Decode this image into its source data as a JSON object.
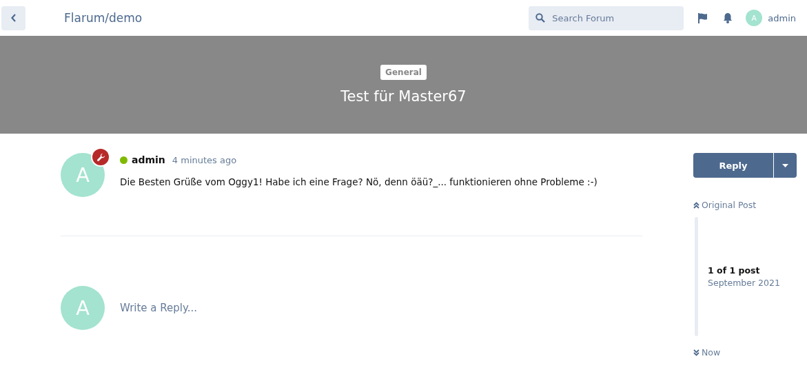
{
  "header": {
    "title": "Flarum/demo",
    "search": {
      "placeholder": "Search Forum"
    },
    "user": {
      "avatar_letter": "A",
      "name": "admin"
    }
  },
  "hero": {
    "tag": "General",
    "title": "Test für Master67"
  },
  "post": {
    "avatar_letter": "A",
    "author": "admin",
    "online": true,
    "time": "4 minutes ago",
    "body": "Die Besten Grüße vom Oggy1! Habe ich eine Frage? Nö, denn öäü?_... funktionieren ohne Probleme :-)"
  },
  "composer": {
    "avatar_letter": "A",
    "placeholder": "Write a Reply..."
  },
  "sidebar": {
    "reply_button": "Reply",
    "original_post": "Original Post",
    "position": "1 of 1 post",
    "date": "September 2021",
    "now": "Now"
  }
}
